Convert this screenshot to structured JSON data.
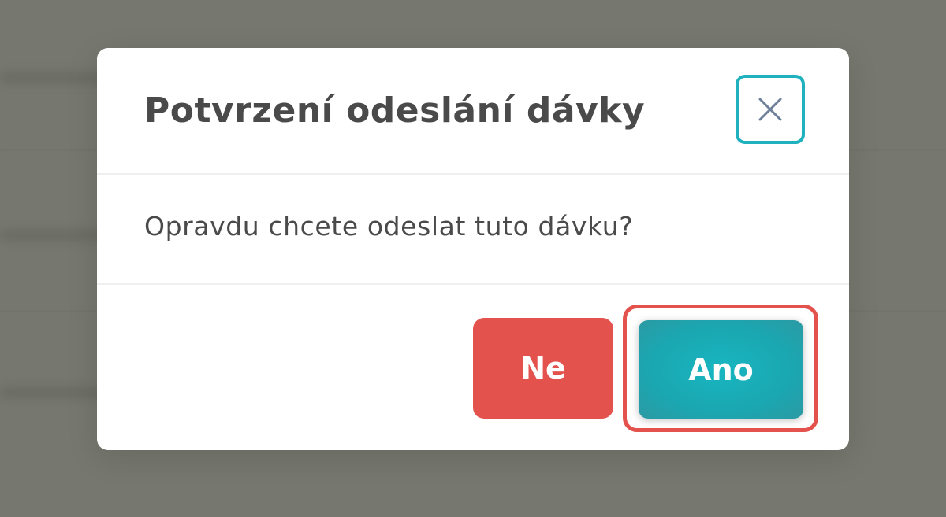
{
  "dialog": {
    "title": "Potvrzení odeslání dávky",
    "message": "Opravdu chcete odeslat tuto dávku?",
    "no_label": "Ne",
    "yes_label": "Ano",
    "close_icon": "close-icon"
  },
  "colors": {
    "overlay": "#76786f",
    "danger": "#e4524d",
    "primary": "#1aa7b1",
    "focus_ring": "#1fb1bd",
    "text": "#4a4a4a"
  }
}
